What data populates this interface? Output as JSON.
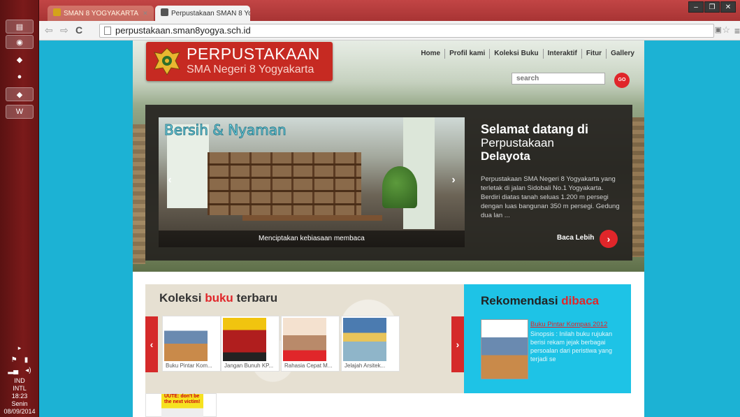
{
  "browser": {
    "tabs": [
      {
        "label": "SMAN 8 YOGYAKARTA"
      },
      {
        "label": "Perpustakaan SMAN 8 Yo"
      }
    ],
    "address": "perpustakaan.sman8yogya.sch.id"
  },
  "taskbar": {
    "lang1": "IND",
    "lang2": "INTL",
    "time": "18:23",
    "day": "Senin",
    "date": "08/09/2014"
  },
  "header": {
    "logo_title": "PERPUSTAKAAN",
    "logo_subtitle": "SMA Negeri 8 Yogyakarta",
    "nav": [
      "Home",
      "Profil kami",
      "Koleksi Buku",
      "Interaktif",
      "Fitur",
      "Gallery"
    ],
    "search_placeholder": "search",
    "go_label": "GO"
  },
  "slider": {
    "slide_title": "Bersih & Nyaman",
    "caption": "Menciptakan kebiasaan membaca",
    "prev": "‹",
    "next": "›"
  },
  "welcome": {
    "line1": "Selamat datang di",
    "line2": "Perpustakaan",
    "line3": "Delayota",
    "body": "Perpustakaan SMA Negeri 8 Yogyakarta yang terletak di jalan Sidobali No.1 Yogyakarta. Berdiri diatas tanah seluas 1.200 m persegi dengan luas bangunan 350 m persegi. Gedung dua lan ...",
    "more": "Baca Lebih",
    "more_icon": "›"
  },
  "koleksi": {
    "title_a": "Koleksi ",
    "title_b": "buku",
    "title_c": " terbaru",
    "prev": "‹",
    "next": "›",
    "books": [
      {
        "caption": "Buku Pintar Kom..."
      },
      {
        "caption": "Jangan Bunuh KP..."
      },
      {
        "caption": "Rahasia Cepat M..."
      },
      {
        "caption": "Jelajah Arsitek..."
      }
    ],
    "extra_cover_text": "UUTE: don't be the next victim!"
  },
  "rekomendasi": {
    "title_a": "Rekomendasi ",
    "title_b": "dibaca",
    "book_title": "Buku Pintar Kompas 2012",
    "synopsis": "Sinopsis : Inilah buku rujukan berisi rekam jejak berbagai persoalan dari peristiwa yang terjadi se"
  }
}
